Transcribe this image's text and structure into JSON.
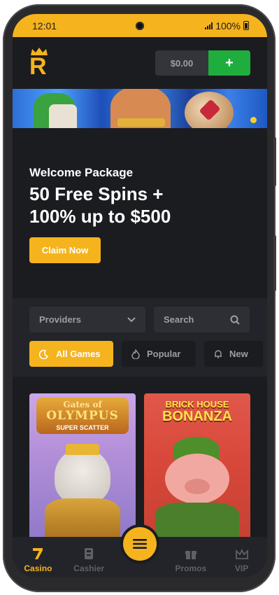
{
  "status_bar": {
    "time": "12:01",
    "battery": "100%"
  },
  "header": {
    "logo_letter": "R",
    "balance": "$0.00",
    "deposit_label": "+"
  },
  "promo": {
    "subtitle": "Welcome Package",
    "title_line1": "50 Free Spins +",
    "title_line2": "100% up to $500",
    "claim_label": "Claim Now"
  },
  "filters": {
    "providers_label": "Providers",
    "search_placeholder": "Search",
    "tabs": [
      {
        "label": "All Games",
        "active": true
      },
      {
        "label": "Popular",
        "active": false
      },
      {
        "label": "New",
        "active": false
      }
    ]
  },
  "games": [
    {
      "title_line1": "Gates of",
      "title_line2": "OLYMPUS",
      "title_line3": "SUPER SCATTER"
    },
    {
      "title_line1": "BRICK HOUSE",
      "title_line2": "BONANZA"
    }
  ],
  "bottom_nav": {
    "items": [
      {
        "label": "Casino",
        "active": true
      },
      {
        "label": "Cashier",
        "active": false
      },
      {
        "label": "Promos",
        "active": false
      },
      {
        "label": "VIP",
        "active": false
      }
    ]
  },
  "colors": {
    "accent": "#f5b31d",
    "success": "#1fae3d",
    "background": "#1b1c20",
    "panel": "#232429"
  }
}
